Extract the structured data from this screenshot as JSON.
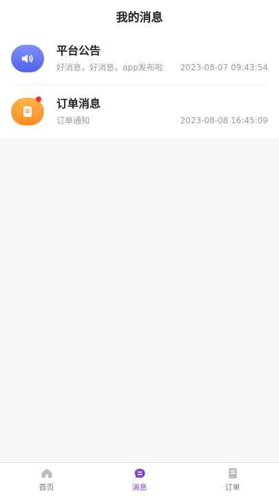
{
  "header": {
    "title": "我的消息"
  },
  "messages": [
    {
      "title": "平台公告",
      "preview": "好消息，好消息，app发布啦",
      "time": "2023-08-07 09:43:54",
      "icon": "speaker-icon",
      "color": "#5b6ef0",
      "unread": false
    },
    {
      "title": "订单消息",
      "preview": "订单通知",
      "time": "2023-08-08 16:45:09",
      "icon": "document-icon",
      "color": "#ff9a30",
      "unread": true
    }
  ],
  "tabbar": {
    "items": [
      {
        "label": "首页",
        "icon": "home-icon",
        "active": false
      },
      {
        "label": "消息",
        "icon": "message-icon",
        "active": true
      },
      {
        "label": "订单",
        "icon": "order-icon",
        "active": false
      }
    ]
  },
  "colors": {
    "accent": "#7b3fe4",
    "background": "#f7f7f7"
  }
}
